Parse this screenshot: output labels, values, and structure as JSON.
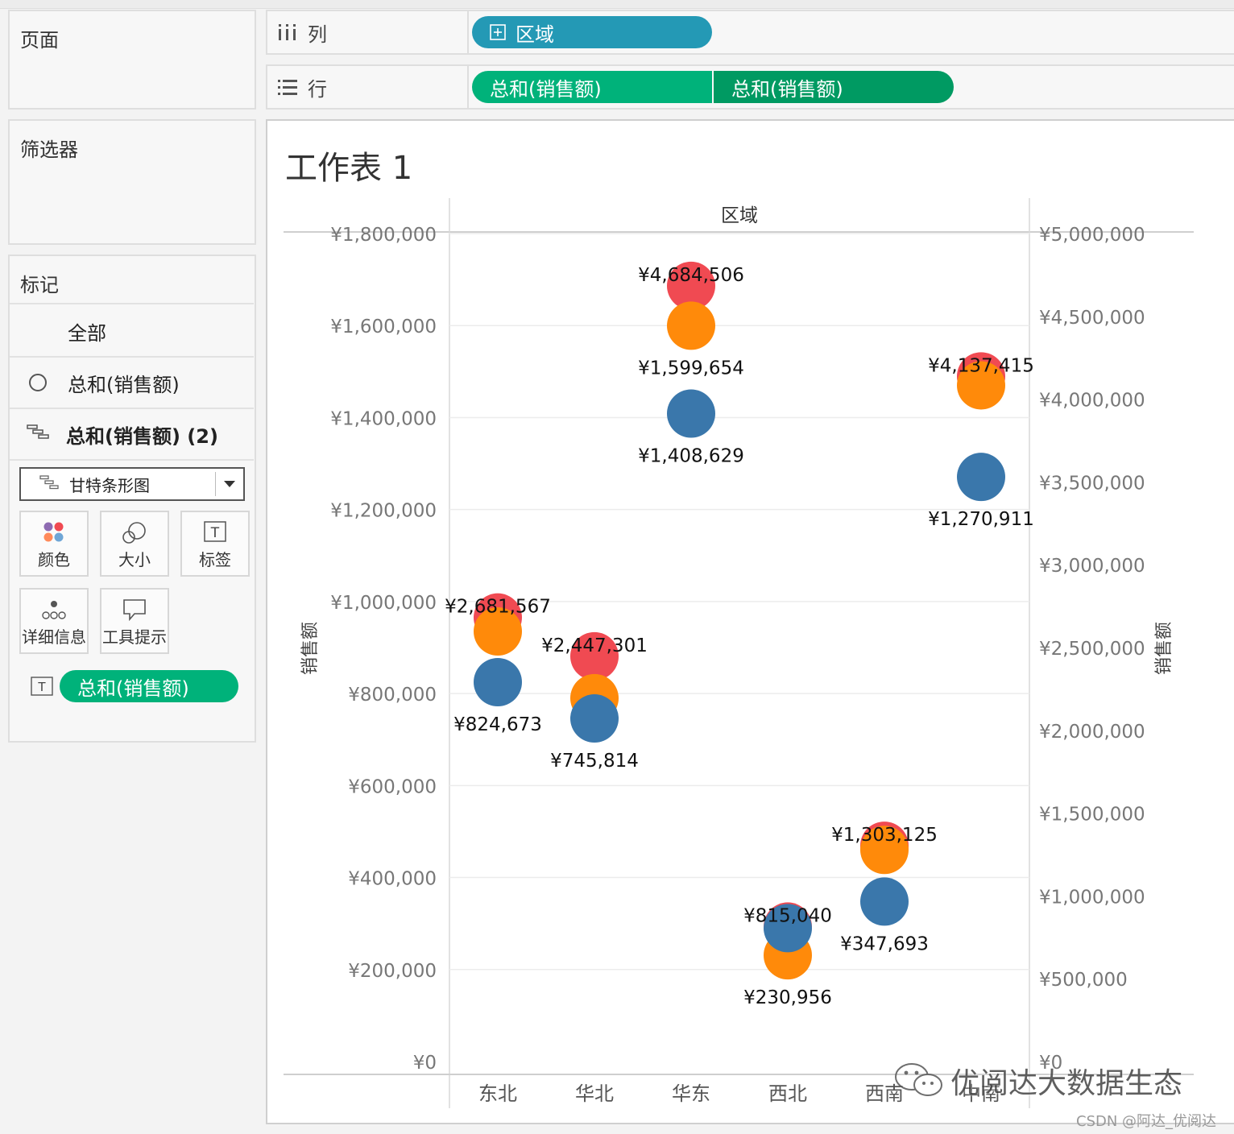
{
  "top_tabs": [],
  "pages_panel": {
    "title": "页面"
  },
  "filters_panel": {
    "title": "筛选器"
  },
  "marks_panel": {
    "title": "标记",
    "rows": [
      {
        "label": "全部",
        "icon": "none"
      },
      {
        "label": "总和(销售额)",
        "icon": "circle-icon"
      },
      {
        "label": "总和(销售额) (2)",
        "icon": "gantt-icon"
      }
    ],
    "mark_type": "甘特条形图",
    "cards": [
      "颜色",
      "大小",
      "标签",
      "详细信息",
      "工具提示"
    ],
    "label_pill": "总和(销售额)"
  },
  "columns_shelf": {
    "label": "列",
    "pill": "区域"
  },
  "rows_shelf": {
    "label": "行",
    "pills": [
      "总和(销售额)",
      "总和(销售额)"
    ]
  },
  "colors": {
    "blue_pill": "#2499b5",
    "green_pill": "#00b27a",
    "green_pill_dark": "#009a62",
    "series_red": "#f04a52",
    "series_orange": "#ff8a0a",
    "series_blue": "#3a77ab"
  },
  "sheet_title": "工作表 1",
  "watermark": "优阅达大数据生态",
  "credit": "CSDN @阿达_优阅达",
  "chart_data": {
    "type": "scatter",
    "header": "区域",
    "categories": [
      "东北",
      "华北",
      "华东",
      "西北",
      "西南",
      "中南"
    ],
    "left_axis": {
      "label": "销售额",
      "ylim": [
        0,
        1800000
      ],
      "ticks": [
        "¥0",
        "¥200,000",
        "¥400,000",
        "¥600,000",
        "¥800,000",
        "¥1,000,000",
        "¥1,200,000",
        "¥1,400,000",
        "¥1,600,000",
        "¥1,800,000"
      ],
      "tick_values": [
        0,
        200000,
        400000,
        600000,
        800000,
        1000000,
        1200000,
        1400000,
        1600000,
        1800000
      ]
    },
    "right_axis": {
      "label": "销售额",
      "ylim": [
        0,
        5000000
      ],
      "ticks": [
        "¥0",
        "¥500,000",
        "¥1,000,000",
        "¥1,500,000",
        "¥2,000,000",
        "¥2,500,000",
        "¥3,000,000",
        "¥3,500,000",
        "¥4,000,000",
        "¥4,500,000",
        "¥5,000,000"
      ],
      "tick_values": [
        0,
        500000,
        1000000,
        1500000,
        2000000,
        2500000,
        3000000,
        3500000,
        4000000,
        4500000,
        5000000
      ]
    },
    "series": [
      {
        "color": "#f04a52",
        "axis": "right",
        "values": [
          2681567,
          2447301,
          4684506,
          815040,
          1303125,
          4137415
        ],
        "labels": [
          "¥2,681,567",
          "¥2,447,301",
          "¥4,684,506",
          "¥815,040",
          "¥1,303,125",
          "¥4,137,415"
        ]
      },
      {
        "color": "#ff8a0a",
        "axis": "left",
        "values": [
          935000,
          790000,
          1599654,
          230956,
          460000,
          1470000
        ],
        "labels": [
          "",
          "",
          "¥1,599,654",
          "¥230,956",
          "",
          ""
        ]
      },
      {
        "color": "#3a77ab",
        "axis": "left",
        "values": [
          824673,
          745814,
          1408629,
          290000,
          347693,
          1270911
        ],
        "labels": [
          "¥824,673",
          "¥745,814",
          "¥1,408,629",
          "",
          "¥347,693",
          "¥1,270,911"
        ]
      }
    ]
  }
}
